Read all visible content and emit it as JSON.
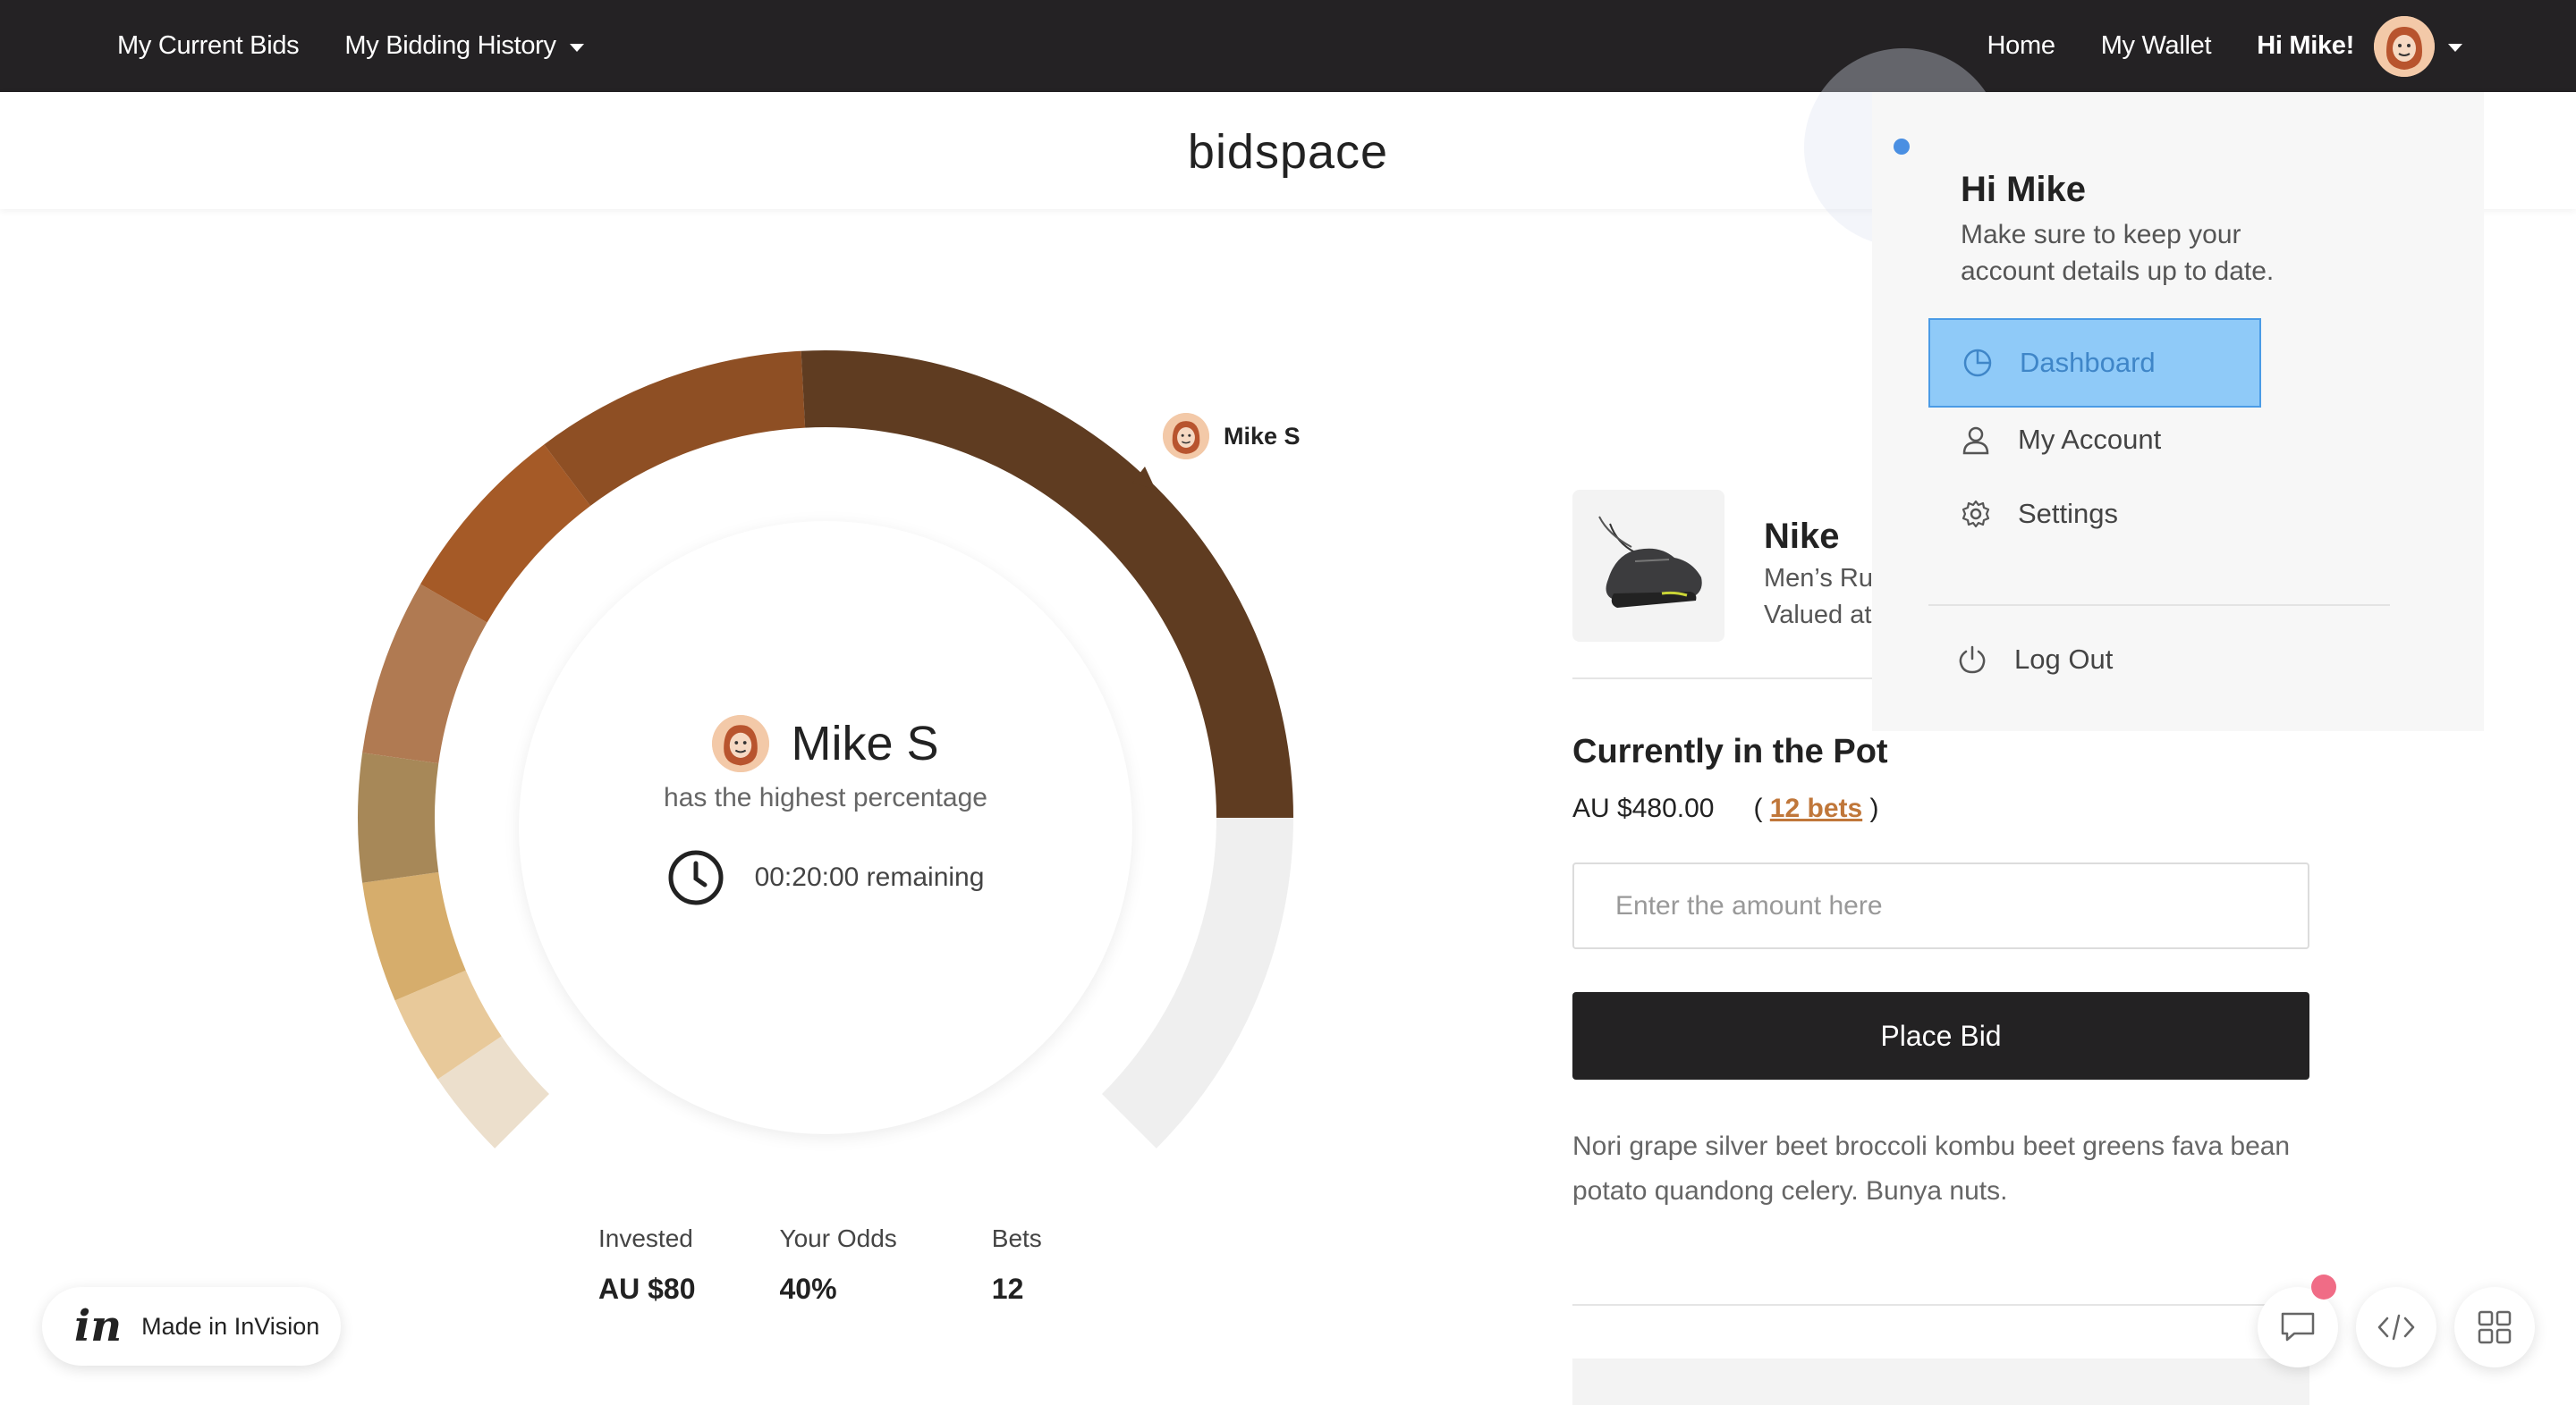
{
  "topnav": {
    "current_bids": "My Current Bids",
    "bidding_history": "My Bidding History",
    "home": "Home",
    "wallet": "My Wallet",
    "greeting": "Hi Mike!"
  },
  "brand": "bidspace",
  "gauge": {
    "leader_tag": "Mike S",
    "leader_name": "Mike S",
    "leader_sub": "has the highest percentage",
    "timer": "00:20:00 remaining",
    "segment_colors": [
      "#ecdfcc",
      "#e8c99a",
      "#d6ad6c",
      "#a78858",
      "#b07a52",
      "#a55a27",
      "#8e4f24",
      "#5f3c21"
    ],
    "remaining_color": "#efefef"
  },
  "stats": [
    {
      "label": "Invested",
      "value": "AU $80"
    },
    {
      "label": "Your Odds",
      "value": "40%"
    },
    {
      "label": "Bets",
      "value": "12"
    }
  ],
  "product": {
    "title": "Nike",
    "line1": "Men’s Ru",
    "line2": "Valued at"
  },
  "pot": {
    "title": "Currently in the Pot",
    "amount": "AU $480.00",
    "bets_open": "(",
    "bets_link": "12 bets",
    "bets_close": ")"
  },
  "bid": {
    "placeholder": "Enter the amount here",
    "button": "Place Bid"
  },
  "description": "Nori grape silver beet broccoli kombu beet greens fava bean potato quandong celery. Bunya nuts.",
  "dropdown": {
    "title": "Hi Mike",
    "subtitle": "Make sure to keep your account details up to date.",
    "items": [
      {
        "label": "Dashboard",
        "icon": "pie-chart-icon"
      },
      {
        "label": "My Account",
        "icon": "user-icon"
      },
      {
        "label": "Settings",
        "icon": "gear-icon"
      },
      {
        "label": "Log Out",
        "icon": "power-icon"
      }
    ]
  },
  "invision": {
    "logo": "in",
    "label": "Made in InVision"
  }
}
